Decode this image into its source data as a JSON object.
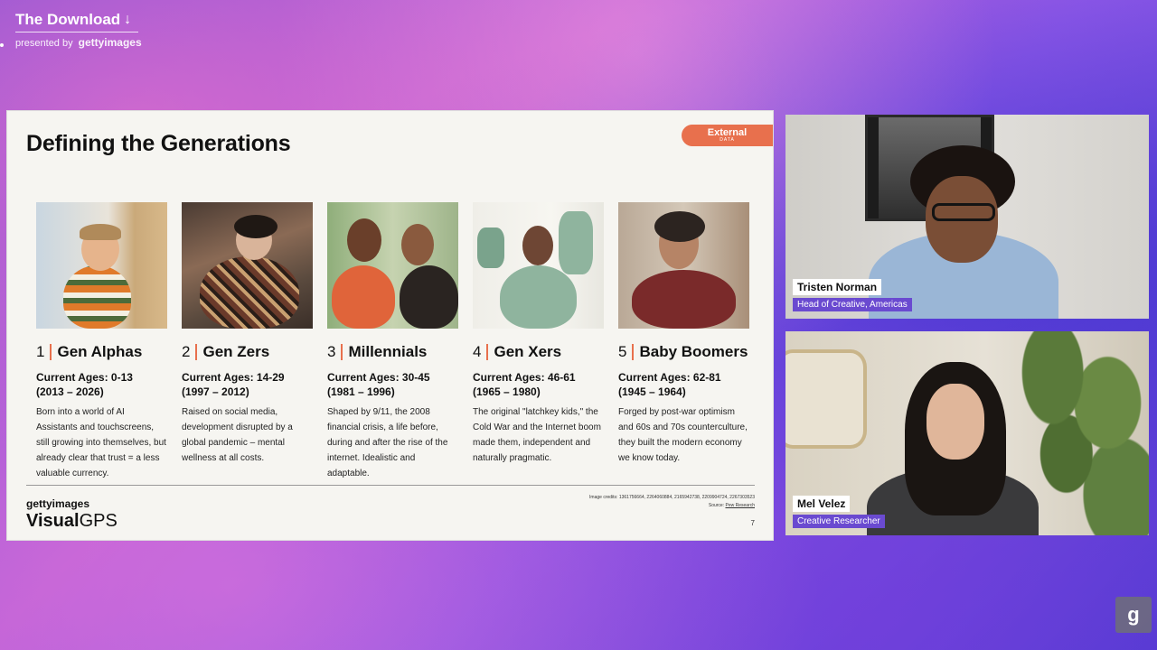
{
  "brand": {
    "title": "The Download",
    "presented_by": "presented by",
    "sponsor": "gettyimages"
  },
  "slide": {
    "title": "Defining the Generations",
    "badge": {
      "label": "External",
      "sublabel": "DATA"
    },
    "generations": [
      {
        "number": "1",
        "name": "Gen Alphas",
        "ages": "Current Ages: 0-13",
        "years": "(2013 – 2026)",
        "description": "Born into a world of AI Assistants and touchscreens, still growing into themselves, but already clear that trust = a less valuable currency."
      },
      {
        "number": "2",
        "name": "Gen Zers",
        "ages": "Current Ages: 14-29",
        "years": "(1997 – 2012)",
        "description": "Raised on social media, development disrupted by a global pandemic – mental wellness at all costs."
      },
      {
        "number": "3",
        "name": "Millennials",
        "ages": "Current Ages: 30-45",
        "years": "(1981 – 1996)",
        "description": "Shaped by 9/11, the 2008 financial crisis, a life before, during and after the rise of the internet. Idealistic and adaptable."
      },
      {
        "number": "4",
        "name": "Gen Xers",
        "ages": "Current Ages: 46-61",
        "years": "(1965 – 1980)",
        "description": "The original \"latchkey kids,\" the Cold War and the Internet boom made them, independent and naturally pragmatic."
      },
      {
        "number": "5",
        "name": "Baby Boomers",
        "ages": "Current Ages: 62-81",
        "years": "(1945 – 1964)",
        "description": "Forged by post-war optimism and 60s and 70s counterculture, they built the modern economy we know today."
      }
    ],
    "logo": {
      "top": "gettyimages",
      "bold": "Visual",
      "light": "GPS"
    },
    "credits": "Image credits: 1361756664, 2264060884, 2165942738, 2209904724, 2267303523",
    "source_label": "Source:",
    "source_link": "Pew Research",
    "page_number": "7"
  },
  "participants": [
    {
      "name": "Tristen Norman",
      "role": "Head of Creative, Americas"
    },
    {
      "name": "Mel Velez",
      "role": "Creative Researcher"
    }
  ],
  "corner_button": {
    "label": "g"
  },
  "colors": {
    "accent": "#e8704d",
    "role_tag": "#6a4ad0"
  }
}
